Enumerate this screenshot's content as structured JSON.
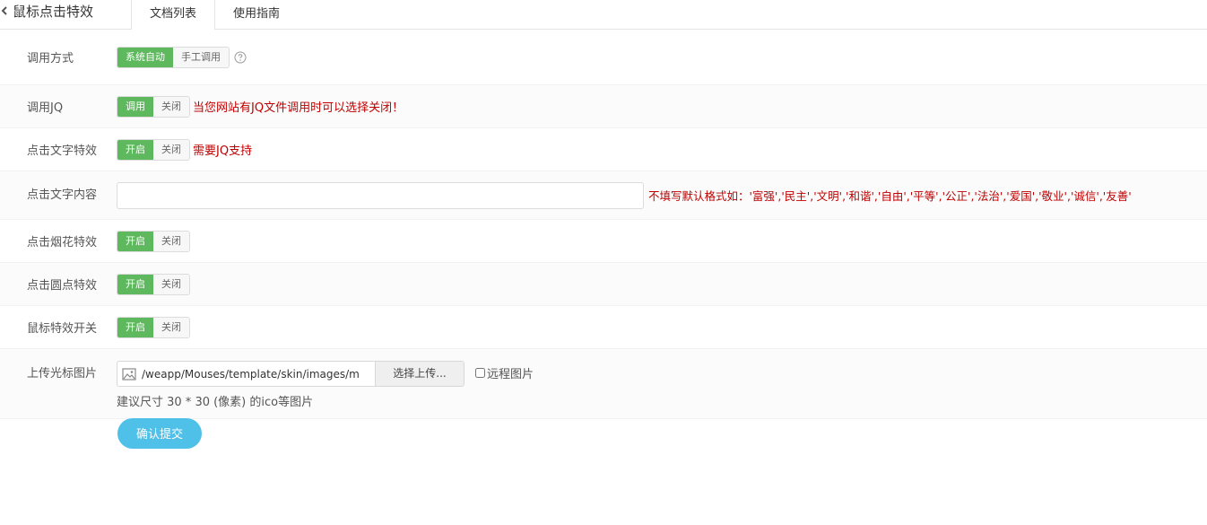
{
  "header": {
    "title": "鼠标点击特效",
    "tabs": [
      {
        "label": "文档列表",
        "active": true
      },
      {
        "label": "使用指南",
        "active": false
      }
    ]
  },
  "form": {
    "call_mode": {
      "label": "调用方式",
      "options": [
        "系统自动",
        "手工调用"
      ],
      "selected": "系统自动"
    },
    "call_jq": {
      "label": "调用JQ",
      "options": [
        "调用",
        "关闭"
      ],
      "selected": "调用",
      "hint": "当您网站有JQ文件调用时可以选择关闭！"
    },
    "text_effect": {
      "label": "点击文字特效",
      "options": [
        "开启",
        "关闭"
      ],
      "selected": "开启",
      "hint": "需要JQ支持"
    },
    "text_content": {
      "label": "点击文字内容",
      "value": "",
      "hint": "不填写默认格式如：'富强','民主','文明','和谐','自由','平等','公正','法治','爱国','敬业','诚信','友善'"
    },
    "firework_effect": {
      "label": "点击烟花特效",
      "options": [
        "开启",
        "关闭"
      ],
      "selected": "开启"
    },
    "dot_effect": {
      "label": "点击圆点特效",
      "options": [
        "开启",
        "关闭"
      ],
      "selected": "开启"
    },
    "mouse_switch": {
      "label": "鼠标特效开关",
      "options": [
        "开启",
        "关闭"
      ],
      "selected": "开启"
    },
    "cursor_image": {
      "label": "上传光标图片",
      "path": "/weapp/Mouses/template/skin/images/m",
      "upload_label": "选择上传...",
      "remote_label": "远程图片",
      "remote_checked": false,
      "size_hint": "建议尺寸 30 * 30 (像素) 的ico等图片"
    },
    "submit_label": "确认提交"
  },
  "colors": {
    "active_toggle": "#5eb95e",
    "hint_red": "#c00000",
    "submit": "#4fc0e8"
  }
}
